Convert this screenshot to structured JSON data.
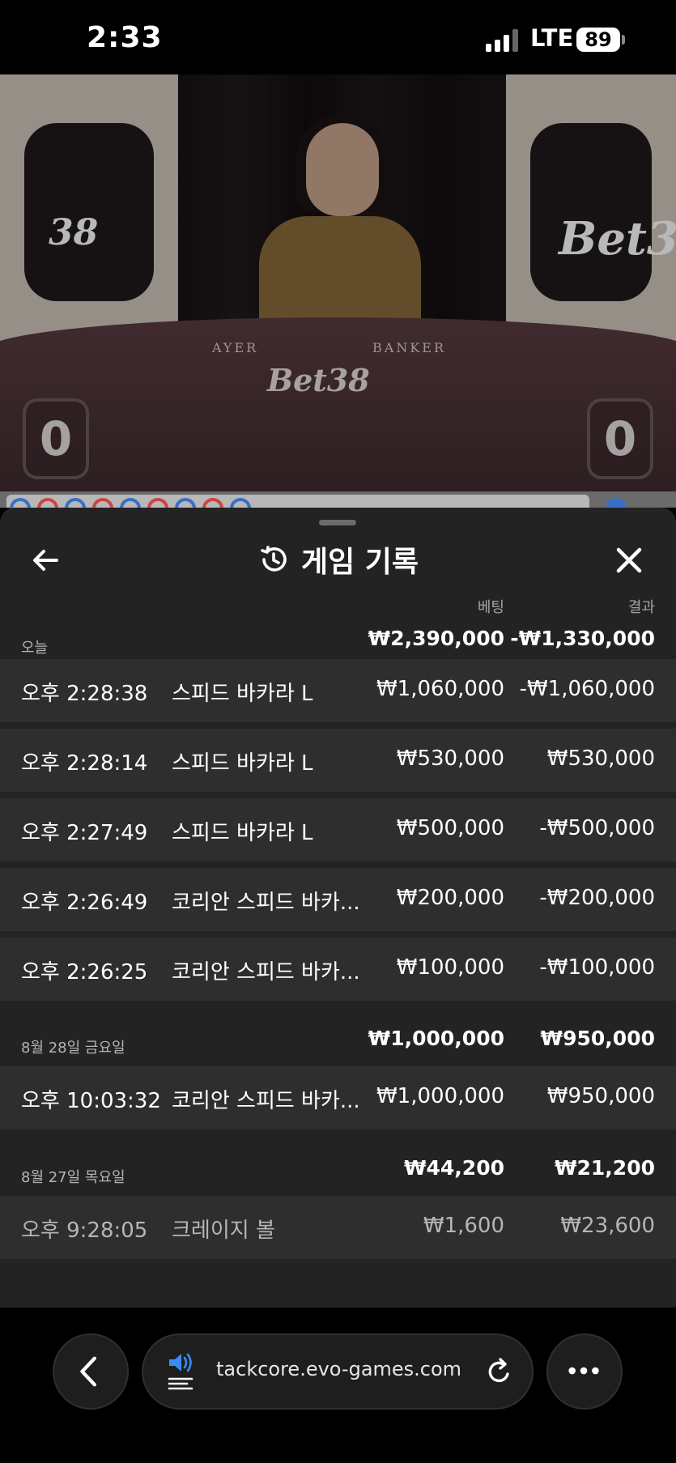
{
  "status_bar": {
    "time": "2:33",
    "network": "LTE",
    "battery": "89"
  },
  "video": {
    "score_player": "0",
    "score_banker": "0",
    "table_label_player": "PLAYER",
    "table_label_banker": "BANKER",
    "brand": "Bet38"
  },
  "panel": {
    "title": "게임 기록",
    "col_bet": "베팅",
    "col_result": "결과",
    "groups": [
      {
        "date": "오늘",
        "bet_total": "₩2,390,000",
        "result_total": "-₩1,330,000",
        "rows": [
          {
            "time": "오후 2:28:38",
            "game": "스피드 바카라 L",
            "bet": "₩1,060,000",
            "result": "-₩1,060,000"
          },
          {
            "time": "오후 2:28:14",
            "game": "스피드 바카라 L",
            "bet": "₩530,000",
            "result": "₩530,000"
          },
          {
            "time": "오후 2:27:49",
            "game": "스피드 바카라 L",
            "bet": "₩500,000",
            "result": "-₩500,000"
          },
          {
            "time": "오후 2:26:49",
            "game": "코리안 스피드 바카...",
            "bet": "₩200,000",
            "result": "-₩200,000"
          },
          {
            "time": "오후 2:26:25",
            "game": "코리안 스피드 바카...",
            "bet": "₩100,000",
            "result": "-₩100,000"
          }
        ]
      },
      {
        "date": "8월 28일 금요일",
        "bet_total": "₩1,000,000",
        "result_total": "₩950,000",
        "rows": [
          {
            "time": "오후 10:03:32",
            "game": "코리안 스피드 바카...",
            "bet": "₩1,000,000",
            "result": "₩950,000"
          }
        ]
      },
      {
        "date": "8월 27일 목요일",
        "bet_total": "₩44,200",
        "result_total": "₩21,200",
        "rows": [
          {
            "time": "오후 9:28:05",
            "game": "크레이지 볼",
            "bet": "₩1,600",
            "result": "₩23,600"
          }
        ]
      }
    ]
  },
  "browser": {
    "url": "tackcore.evo-games.com"
  },
  "icons": {
    "back": "arrow-left-icon",
    "history": "history-icon",
    "close": "close-icon",
    "nav_back": "chevron-left-icon",
    "audio": "speaker-icon",
    "reload": "reload-icon",
    "more": "more-icon"
  }
}
